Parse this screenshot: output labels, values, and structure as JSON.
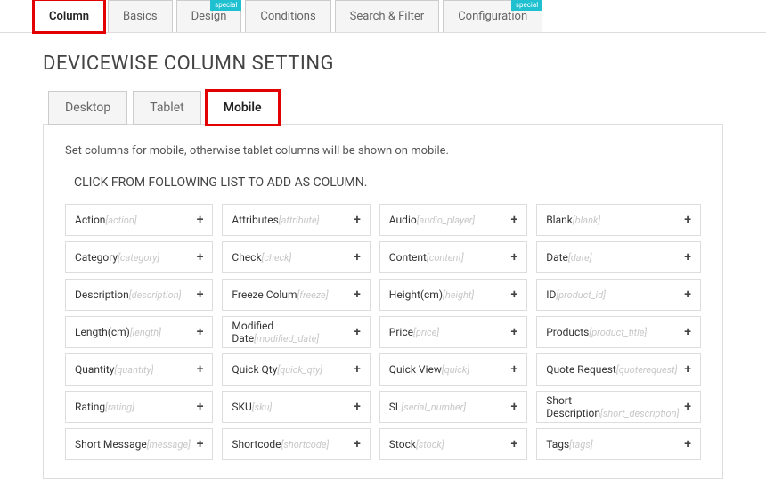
{
  "top_tabs": [
    {
      "label": "Column",
      "active": true,
      "badge": null,
      "highlight": true
    },
    {
      "label": "Basics",
      "active": false,
      "badge": null,
      "highlight": false
    },
    {
      "label": "Design",
      "active": false,
      "badge": "special",
      "highlight": false
    },
    {
      "label": "Conditions",
      "active": false,
      "badge": null,
      "highlight": false
    },
    {
      "label": "Search & Filter",
      "active": false,
      "badge": null,
      "highlight": false
    },
    {
      "label": "Configuration",
      "active": false,
      "badge": "special",
      "highlight": false
    }
  ],
  "page_title": "DEVICEWISE COLUMN SETTING",
  "device_tabs": [
    {
      "label": "Desktop",
      "active": false,
      "highlight": false
    },
    {
      "label": "Tablet",
      "active": false,
      "highlight": false
    },
    {
      "label": "Mobile",
      "active": true,
      "highlight": true
    }
  ],
  "helper_text": "Set columns for mobile, otherwise tablet columns will be shown on mobile.",
  "instruction": "CLICK FROM FOLLOWING LIST TO ADD AS COLUMN.",
  "columns": [
    {
      "label": "Action",
      "slug": "[action]"
    },
    {
      "label": "Attributes",
      "slug": "[attribute]"
    },
    {
      "label": "Audio",
      "slug": "[audio_player]"
    },
    {
      "label": "Blank",
      "slug": "[blank]"
    },
    {
      "label": "Category",
      "slug": "[category]"
    },
    {
      "label": "Check",
      "slug": "[check]"
    },
    {
      "label": "Content",
      "slug": "[content]"
    },
    {
      "label": "Date",
      "slug": "[date]"
    },
    {
      "label": "Description",
      "slug": "[description]"
    },
    {
      "label": "Freeze Colum",
      "slug": "[freeze]"
    },
    {
      "label": "Height(cm)",
      "slug": "[height]"
    },
    {
      "label": "ID",
      "slug": "[product_id]"
    },
    {
      "label": "Length(cm)",
      "slug": "[length]"
    },
    {
      "label": "Modified Date",
      "slug": "[modified_date]"
    },
    {
      "label": "Price",
      "slug": "[price]"
    },
    {
      "label": "Products",
      "slug": "[product_title]"
    },
    {
      "label": "Quantity",
      "slug": "[quantity]"
    },
    {
      "label": "Quick Qty",
      "slug": "[quick_qty]"
    },
    {
      "label": "Quick View",
      "slug": "[quick]"
    },
    {
      "label": "Quote Request",
      "slug": "[quoterequest]"
    },
    {
      "label": "Rating",
      "slug": "[rating]"
    },
    {
      "label": "SKU",
      "slug": "[sku]"
    },
    {
      "label": "SL",
      "slug": "[serial_number]"
    },
    {
      "label": "Short Description",
      "slug": "[short_description]"
    },
    {
      "label": "Short Message",
      "slug": "[message]"
    },
    {
      "label": "Shortcode",
      "slug": "[shortcode]"
    },
    {
      "label": "Stock",
      "slug": "[stock]"
    },
    {
      "label": "Tags",
      "slug": "[tags]"
    }
  ],
  "plus_symbol": "+"
}
